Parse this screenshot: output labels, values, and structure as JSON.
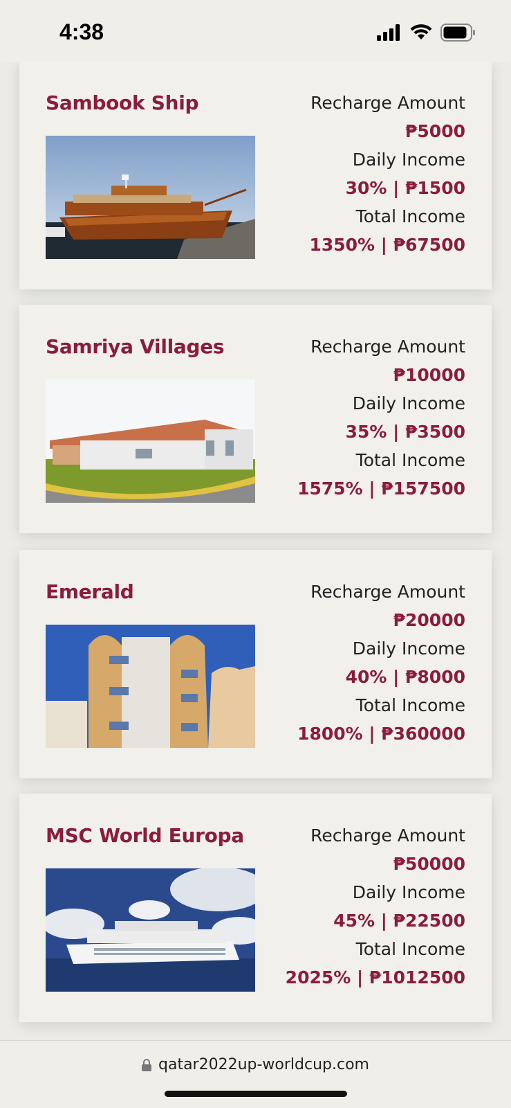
{
  "status": {
    "time": "4:38"
  },
  "cards": [
    {
      "title": "Sambook Ship",
      "image": "wooden-dhow-ship-photo",
      "recharge_label": "Recharge Amount",
      "recharge_value": "₱5000",
      "daily_label": "Daily Income",
      "daily_value": "30% | ₱1500",
      "total_label": "Total Income",
      "total_value": "1350% | ₱67500"
    },
    {
      "title": "Samriya Villages",
      "image": "villa-house-photo",
      "recharge_label": "Recharge Amount",
      "recharge_value": "₱10000",
      "daily_label": "Daily Income",
      "daily_value": "35% | ₱3500",
      "total_label": "Total Income",
      "total_value": "1575% | ₱157500"
    },
    {
      "title": "Emerald",
      "image": "apartment-building-photo",
      "recharge_label": "Recharge Amount",
      "recharge_value": "₱20000",
      "daily_label": "Daily Income",
      "daily_value": "40% | ₱8000",
      "total_label": "Total Income",
      "total_value": "1800% | ₱360000"
    },
    {
      "title": "MSC World Europa",
      "image": "cruise-ship-photo",
      "recharge_label": "Recharge Amount",
      "recharge_value": "₱50000",
      "daily_label": "Daily Income",
      "daily_value": "45% | ₱22500",
      "total_label": "Total Income",
      "total_value": "2025% | ₱1012500"
    }
  ],
  "browser": {
    "url": "qatar2022up-worldcup.com"
  },
  "colors": {
    "accent": "#8a1c3c",
    "card": "#f1f0ea",
    "background": "#ecebe5"
  }
}
